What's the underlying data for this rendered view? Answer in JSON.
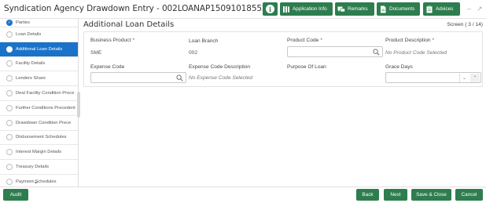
{
  "header": {
    "title": "Syndication Agency Drawdown Entry - 002LOANAP15091018552",
    "buttons": {
      "app_info": "Application Info",
      "remarks": "Remarks",
      "documents": "Documents",
      "advices": "Advices"
    }
  },
  "sidebar": {
    "items": [
      {
        "label": "Parties"
      },
      {
        "label": "Loan Details"
      },
      {
        "label": "Additional Loan Details"
      },
      {
        "label": "Facility Details"
      },
      {
        "label": "Lenders Share"
      },
      {
        "label": "Deal Facility Condition Prece"
      },
      {
        "label": "Further Conditions Precedent"
      },
      {
        "label": "Drawdown Condition Prece"
      },
      {
        "label": "Disbursement Schedules"
      },
      {
        "label": "Interest Margin Details"
      },
      {
        "label": "Treasury Details"
      },
      {
        "label": "Payment Schedules"
      }
    ]
  },
  "main": {
    "title": "Additional Loan Details",
    "screen": "Screen ( 3 / 14)",
    "fields": {
      "business_product": {
        "label": "Business Product",
        "value": "SME"
      },
      "loan_branch": {
        "label": "Loan Branch",
        "value": "002"
      },
      "product_code": {
        "label": "Product Code",
        "value": ""
      },
      "product_description": {
        "label": "Product Description",
        "value": "No Product Code Selected"
      },
      "expense_code": {
        "label": "Expense Code",
        "value": ""
      },
      "expense_code_description": {
        "label": "Expense Code Description",
        "value": "No Expense Code Selected"
      },
      "purpose_of_loan": {
        "label": "Purpose Of Loan"
      },
      "grace_days": {
        "label": "Grace Days",
        "value": ""
      }
    }
  },
  "footer": {
    "audit": "Audit",
    "back": "Back",
    "next": "Next",
    "save_close": "Save & Close",
    "cancel": "Cancel"
  },
  "colors": {
    "accent_green": "#2e7d4f",
    "accent_blue": "#1a73c9"
  }
}
